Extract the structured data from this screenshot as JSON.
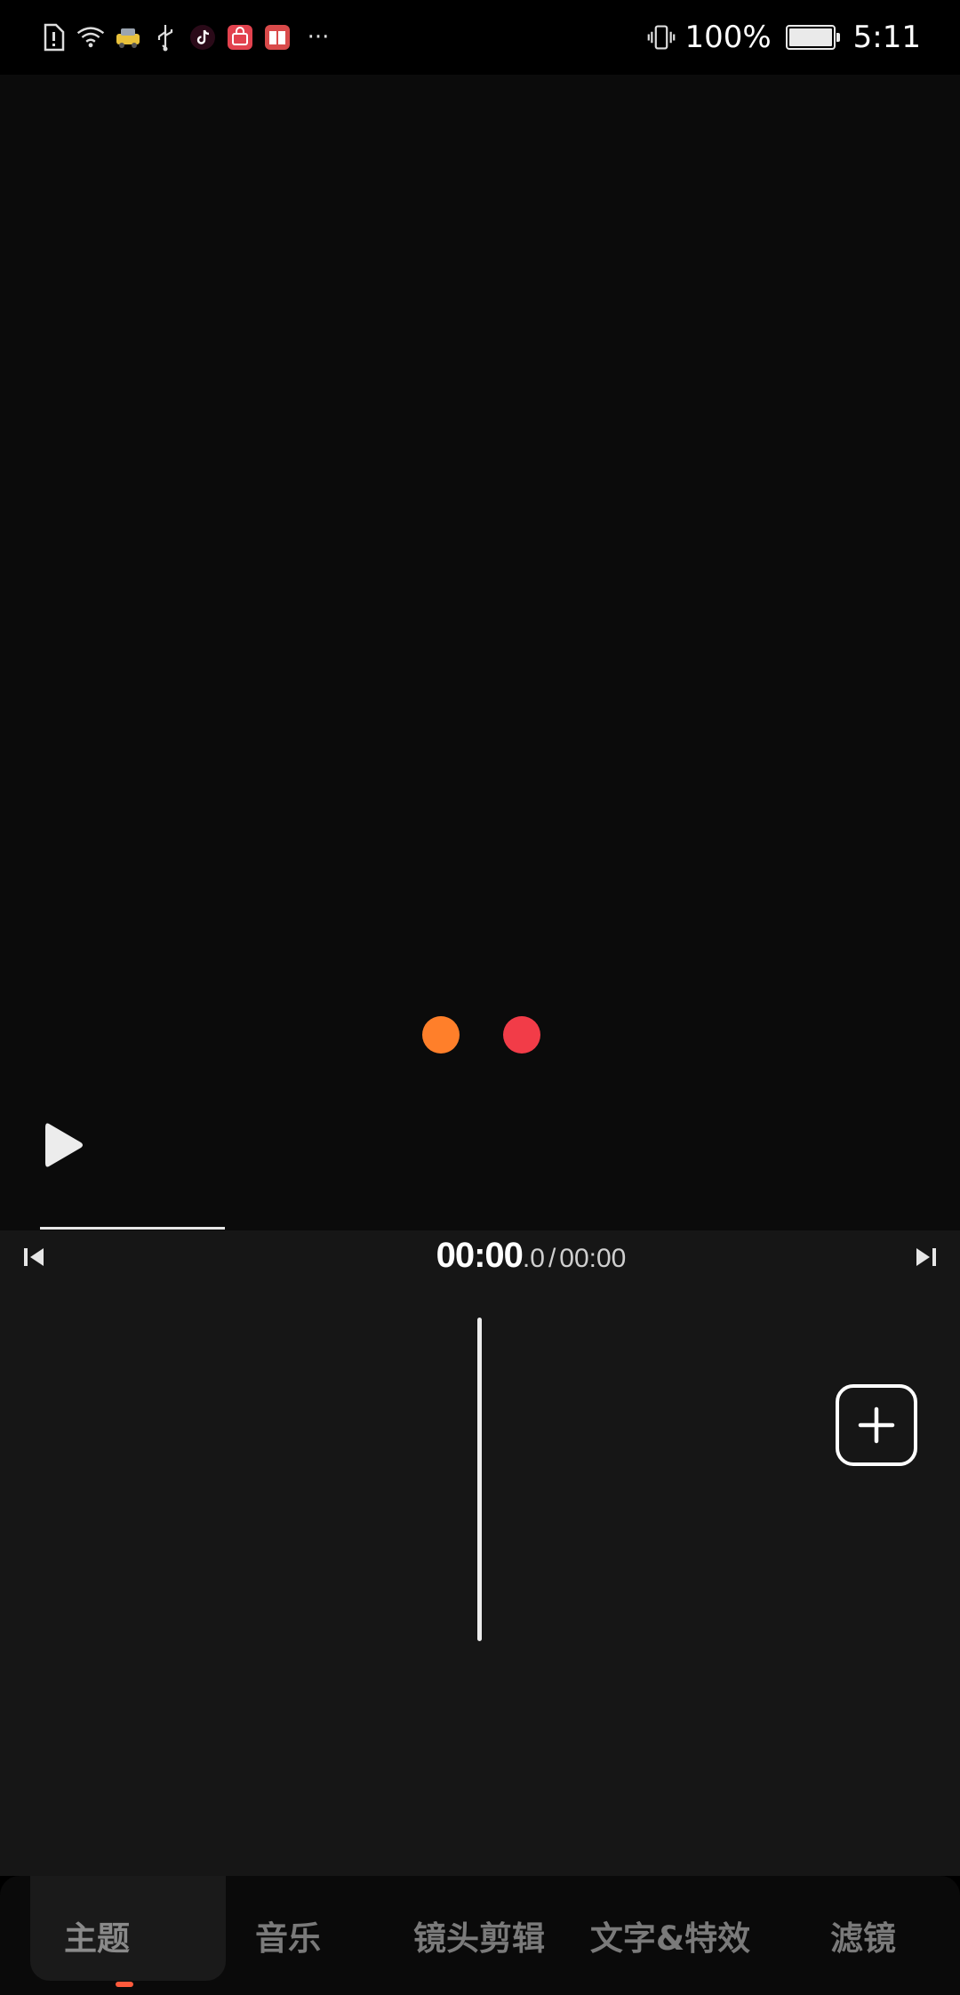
{
  "status_bar": {
    "left_icons": [
      "sim-alert-icon",
      "wifi-icon",
      "taxi-app-icon",
      "usb-icon",
      "tiktok-icon",
      "shopping-app-icon",
      "reader-app-icon",
      "more-notifications-icon"
    ],
    "more_indicator": "···",
    "battery_percent": "100%",
    "battery_level": 1.0,
    "time": "5:11"
  },
  "preview": {
    "loading_dot_colors": [
      "#ff7f2a",
      "#f23c48"
    ],
    "playback_progress": 0.21,
    "play_icon": "play-icon"
  },
  "timeline": {
    "current_main": "00:00",
    "current_fraction": ".0",
    "separator": "/",
    "total": "00:00",
    "skip_start_icon": "skip-to-start-icon",
    "skip_end_icon": "skip-to-end-icon",
    "add_icon": "plus-icon"
  },
  "tabs": [
    {
      "label": "主题",
      "active": true
    },
    {
      "label": "音乐",
      "active": false
    },
    {
      "label": "镜头剪辑",
      "active": false
    },
    {
      "label": "文字&特效",
      "active": false
    },
    {
      "label": "滤镜",
      "active": false
    }
  ],
  "colors": {
    "accent": "#ff5a3c",
    "background": "#0b0b0b",
    "panel": "#161616"
  }
}
